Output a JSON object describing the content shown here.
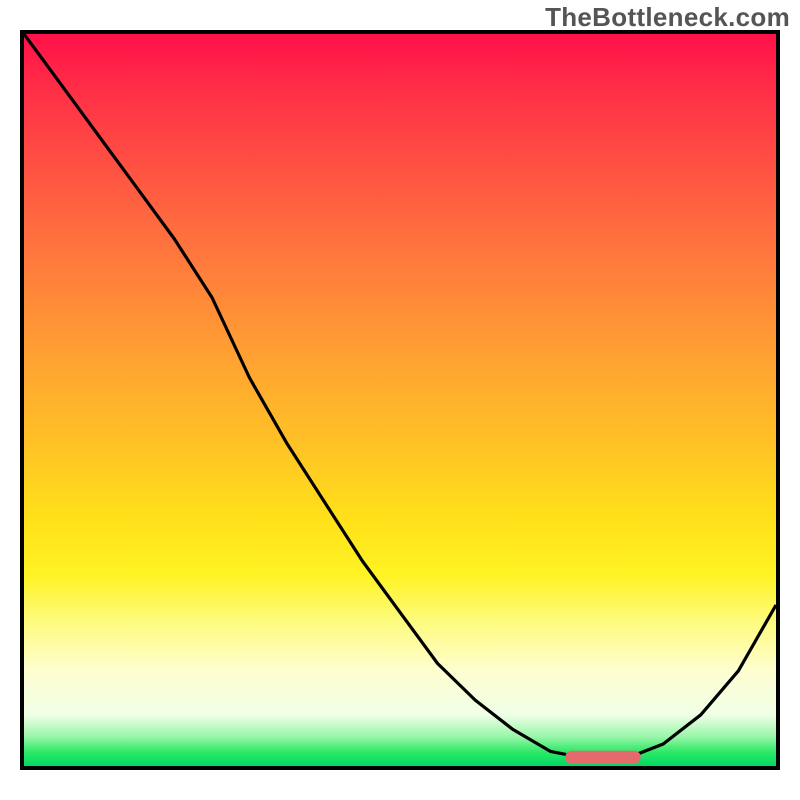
{
  "watermark": "TheBottleneck.com",
  "chart_data": {
    "type": "line",
    "title": "",
    "xlabel": "",
    "ylabel": "",
    "x": [
      0.0,
      0.05,
      0.1,
      0.15,
      0.2,
      0.25,
      0.3,
      0.35,
      0.4,
      0.45,
      0.5,
      0.55,
      0.6,
      0.65,
      0.7,
      0.75,
      0.8,
      0.85,
      0.9,
      0.95,
      1.0
    ],
    "values": [
      1.0,
      0.93,
      0.86,
      0.79,
      0.72,
      0.64,
      0.53,
      0.44,
      0.36,
      0.28,
      0.21,
      0.14,
      0.09,
      0.05,
      0.02,
      0.01,
      0.01,
      0.03,
      0.07,
      0.13,
      0.22
    ],
    "xlim": [
      0,
      1
    ],
    "ylim": [
      0,
      1
    ],
    "marker_segment": {
      "x_start": 0.72,
      "x_end": 0.82,
      "y": 0.012
    },
    "background_gradient": {
      "stops": [
        {
          "pos": 0.0,
          "color": "#ff114a"
        },
        {
          "pos": 0.5,
          "color": "#ffc225"
        },
        {
          "pos": 0.85,
          "color": "#fefed0"
        },
        {
          "pos": 1.0,
          "color": "#00d865"
        }
      ]
    }
  }
}
